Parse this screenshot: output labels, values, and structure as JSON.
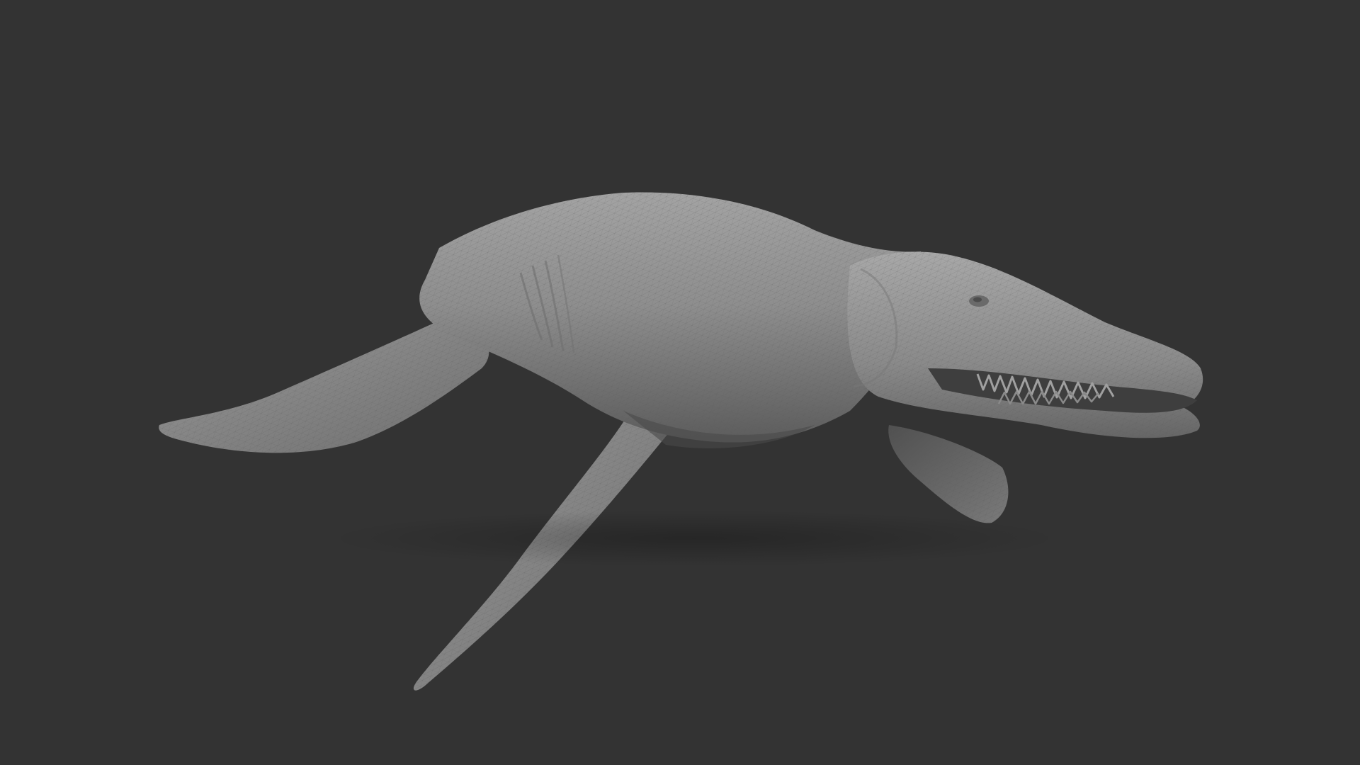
{
  "scene": {
    "background_color": "#333333",
    "model_color": "#8f8f8f",
    "shading": "clay-wireframe",
    "subject_icon": "marine-reptile-sculpt"
  }
}
